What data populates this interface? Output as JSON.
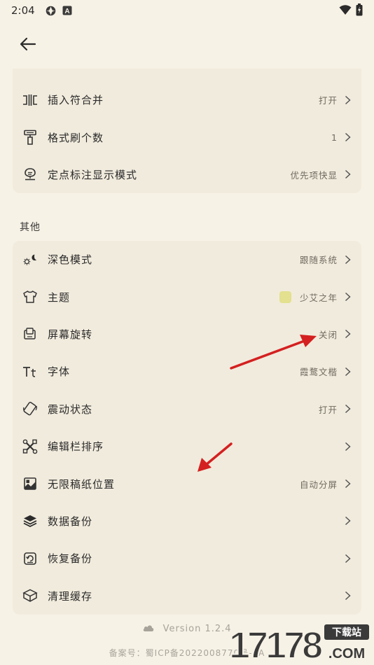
{
  "status_bar": {
    "time": "2:04"
  },
  "colors": {
    "accent_red": "#d42020",
    "theme_swatch": "#e3e08f"
  },
  "card_top": {
    "items": [
      {
        "icon": "merge-insert-icon",
        "label": "插入符合并",
        "value": "打开"
      },
      {
        "icon": "format-brush-icon",
        "label": "格式刷个数",
        "value": "1"
      },
      {
        "icon": "pin-mark-icon",
        "label": "定点标注显示模式",
        "value": "优先项快显"
      }
    ]
  },
  "section_other": {
    "title": "其他"
  },
  "card_other": {
    "items": [
      {
        "icon": "dark-mode-icon",
        "label": "深色模式",
        "value": "跟随系统"
      },
      {
        "icon": "shirt-icon",
        "label": "主题",
        "value": "少艾之年"
      },
      {
        "icon": "screen-rotate-icon",
        "label": "屏幕旋转",
        "value": "关闭"
      },
      {
        "icon": "font-icon",
        "label": "字体",
        "value": "霞鹜文楷"
      },
      {
        "icon": "vibrate-icon",
        "label": "震动状态",
        "value": "打开"
      },
      {
        "icon": "toolbar-sort-icon",
        "label": "编辑栏排序",
        "value": ""
      },
      {
        "icon": "paper-position-icon",
        "label": "无限稿纸位置",
        "value": "自动分屏"
      },
      {
        "icon": "backup-icon",
        "label": "数据备份",
        "value": ""
      },
      {
        "icon": "restore-icon",
        "label": "恢复备份",
        "value": ""
      },
      {
        "icon": "clear-cache-icon",
        "label": "清理缓存",
        "value": ""
      }
    ]
  },
  "footer": {
    "version": "Version 1.2.4",
    "icp": "备案号：蜀ICP备2022008770号-2A"
  },
  "watermark": {
    "number": "17178",
    "tag": "下载站",
    "domain": ".COM"
  }
}
